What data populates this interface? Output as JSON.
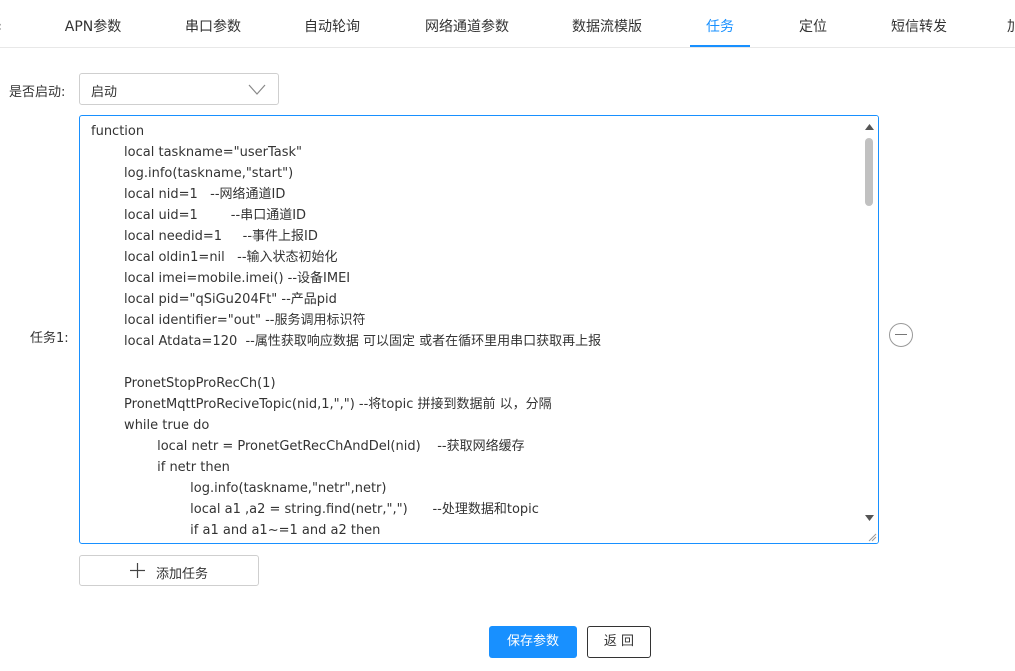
{
  "tabs": [
    {
      "label": "APN参数"
    },
    {
      "label": "串口参数"
    },
    {
      "label": "自动轮询"
    },
    {
      "label": "网络通道参数"
    },
    {
      "label": "数据流模版"
    },
    {
      "label": "任务",
      "active": true
    },
    {
      "label": "定位"
    },
    {
      "label": "短信转发"
    },
    {
      "label": "加"
    }
  ],
  "form": {
    "enable_label": "是否启动:",
    "enable_value": "启动",
    "task_label": "任务1:",
    "code_lines": [
      "function",
      "        local taskname=\"userTask\"",
      "        log.info(taskname,\"start\")",
      "        local nid=1   --网络通道ID",
      "        local uid=1        --串口通道ID",
      "        local needid=1     --事件上报ID",
      "        local oldin1=nil   --输入状态初始化",
      "        local imei=mobile.imei() --设备IMEI",
      "        local pid=\"qSiGu204Ft\" --产品pid",
      "        local identifier=\"out\" --服务调用标识符",
      "        local Atdata=120  --属性获取响应数据 可以固定 或者在循环里用串口获取再上报",
      "",
      "        PronetStopProRecCh(1)",
      "        PronetMqttProReciveTopic(nid,1,\",\") --将topic 拼接到数据前 以，分隔",
      "        while true do",
      "                local netr = PronetGetRecChAndDel(nid)    --获取网络缓存",
      "                if netr then",
      "                        log.info(taskname,\"netr\",netr)",
      "                        local a1 ,a2 = string.find(netr,\",\")      --处理数据和topic",
      "                        if a1 and a1~=1 and a2 then"
    ],
    "add_task_label": "添加任务"
  },
  "actions": {
    "save_label": "保存参数",
    "back_label": "返 回"
  },
  "colors": {
    "accent": "#1890ff",
    "border": "#cfcfcf",
    "text": "#333333"
  }
}
